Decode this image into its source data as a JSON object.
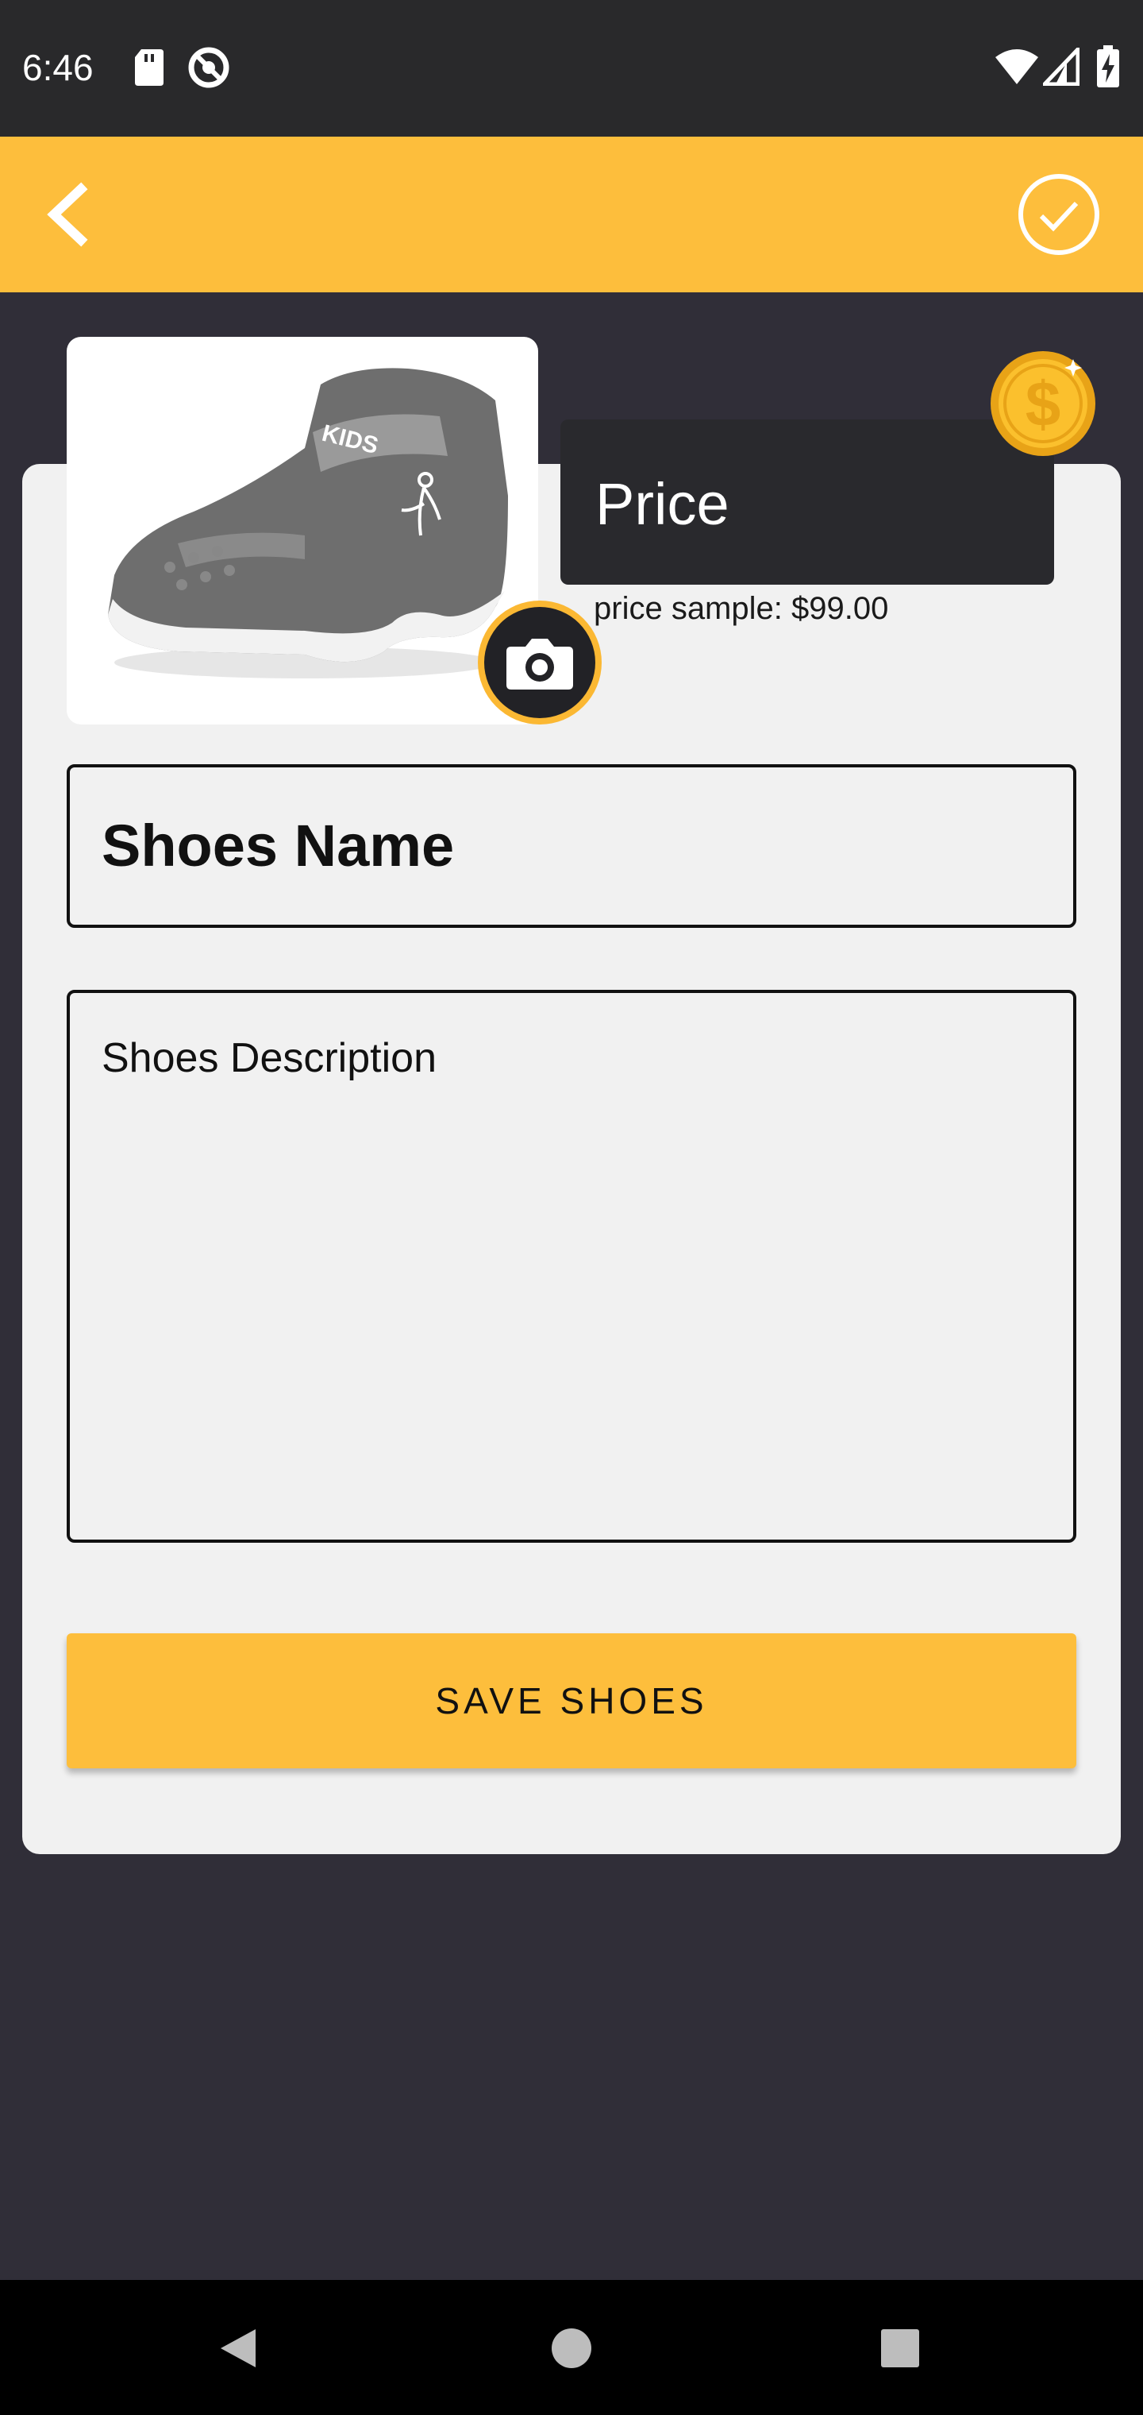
{
  "status": {
    "time": "6:46",
    "icons": [
      "sd-card-icon",
      "do-not-disturb-icon",
      "wifi-icon",
      "signal-icon",
      "battery-charging-icon"
    ]
  },
  "app_bar": {
    "back_icon": "chevron-left-icon",
    "confirm_icon": "check-circle-icon",
    "color": "#fdbe3c"
  },
  "form": {
    "price_placeholder": "Price",
    "price_hint": "price sample: $99.00",
    "name_placeholder": "Shoes Name",
    "description_placeholder": "Shoes Description",
    "save_label": "SAVE SHOES",
    "shoe_logo_text": "KIDS",
    "coin_icon": "dollar-coin-icon",
    "camera_icon": "camera-icon"
  },
  "nav": {
    "icons": [
      "back-triangle-icon",
      "home-circle-icon",
      "recents-square-icon"
    ]
  }
}
